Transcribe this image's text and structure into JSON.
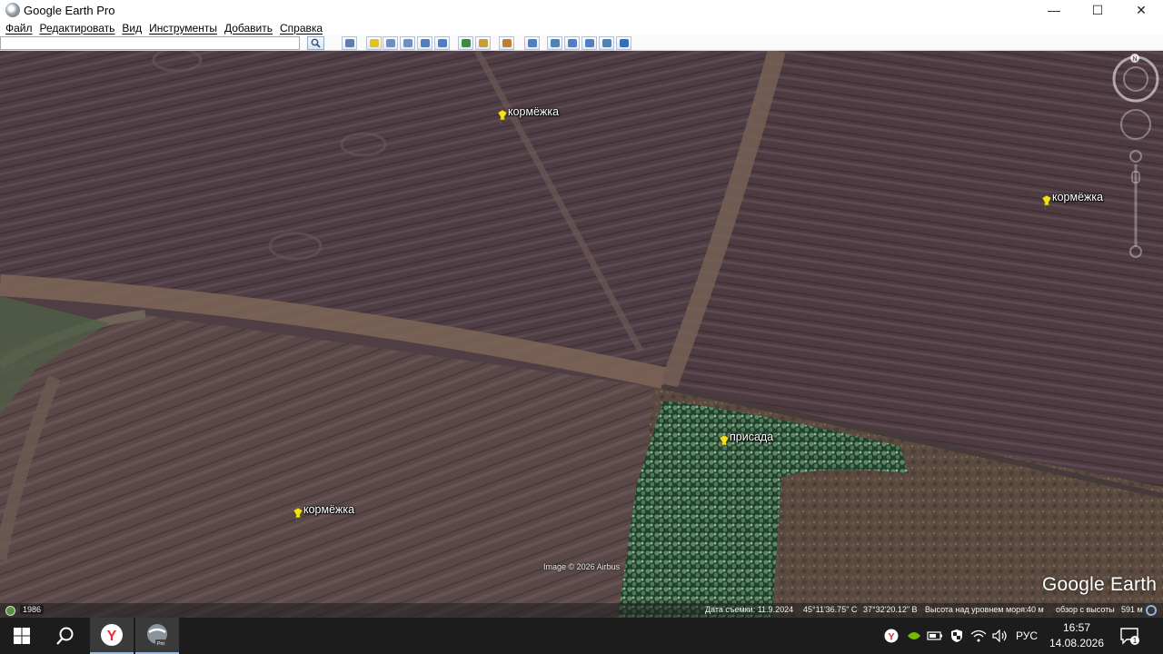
{
  "window": {
    "title": "Google Earth Pro",
    "minimize_glyph": "—",
    "maximize_glyph": "☐",
    "close_glyph": "✕"
  },
  "menu": {
    "items": [
      {
        "label": "Файл"
      },
      {
        "label": "Редактировать"
      },
      {
        "label": "Вид"
      },
      {
        "label": "Инструменты"
      },
      {
        "label": "Добавить"
      },
      {
        "label": "Справка"
      }
    ]
  },
  "toolbar": {
    "search_value": "",
    "buttons": [
      {
        "name": "sidebar-toggle-button",
        "icon": "sidebar-icon",
        "color": "#5a7fb0"
      },
      {
        "name": "add-placemark-button",
        "icon": "pushpin-icon",
        "color": "#e3c21a"
      },
      {
        "name": "add-polygon-button",
        "icon": "polygon-icon",
        "color": "#6a8fc4"
      },
      {
        "name": "add-path-button",
        "icon": "path-icon",
        "color": "#6a8fc4"
      },
      {
        "name": "add-overlay-button",
        "icon": "overlay-icon",
        "color": "#4f7fc0"
      },
      {
        "name": "record-tour-button",
        "icon": "tour-icon",
        "color": "#4f7fc0"
      },
      {
        "name": "historical-imagery-button",
        "icon": "clock-icon",
        "color": "#3f8a3f"
      },
      {
        "name": "sunlight-button",
        "icon": "sun-icon",
        "color": "#c4a032"
      },
      {
        "name": "planets-button",
        "icon": "planet-icon",
        "color": "#c07f2a"
      },
      {
        "name": "ruler-button",
        "icon": "ruler-icon",
        "color": "#4f7fc0"
      },
      {
        "name": "email-button",
        "icon": "email-icon",
        "color": "#4f7fc0"
      },
      {
        "name": "print-button",
        "icon": "print-icon",
        "color": "#4f7fc0"
      },
      {
        "name": "save-image-button",
        "icon": "save-image-icon",
        "color": "#4f7fc0"
      },
      {
        "name": "view-in-maps-button",
        "icon": "maps-icon",
        "color": "#4f7fc0"
      },
      {
        "name": "earth-gallery-button",
        "icon": "globe-icon",
        "color": "#2f6fc0"
      }
    ]
  },
  "map": {
    "placemarks": [
      {
        "label": "кормёжка"
      },
      {
        "label": "кормёжка"
      },
      {
        "label": "присада"
      },
      {
        "label": "кормёжка"
      }
    ],
    "image_credit": "Image © 2026 Airbus",
    "logo": "Google Earth",
    "north_label": "N"
  },
  "status": {
    "historical_year": "1986",
    "capture_date": "Дата съемки: 11.9.2024",
    "latitude": "45°11'36.75\" С",
    "longitude": "37°32'20.12\" В",
    "elevation_label": "Высота над уровнем моря:",
    "elevation_value": "40 м",
    "eye_alt_label": "обзор с высоты",
    "eye_alt_value": "591 м"
  },
  "taskbar": {
    "start_icon": "windows-icon",
    "search_icon": "search-icon",
    "apps": [
      {
        "name": "yandex-browser-taskbar-icon",
        "letter": "Y"
      },
      {
        "name": "google-earth-taskbar-icon",
        "letter": "Pro"
      }
    ],
    "language": "РУС",
    "time": "16:57",
    "date": "14.08.2026",
    "notifications_count": "1"
  }
}
